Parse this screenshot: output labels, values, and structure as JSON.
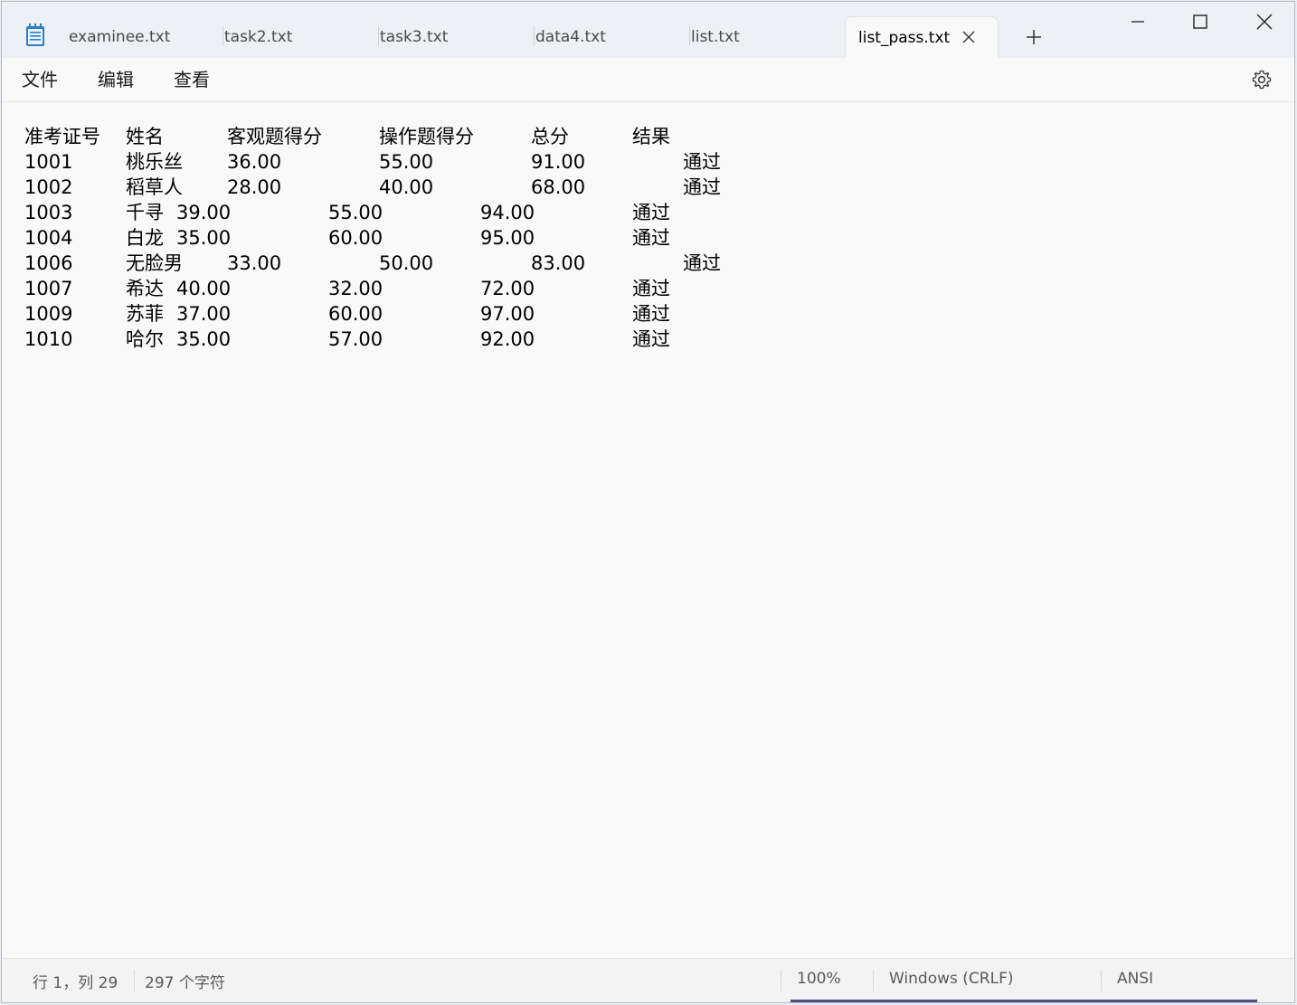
{
  "tabs": [
    {
      "label": "examinee.txt"
    },
    {
      "label": "task2.txt"
    },
    {
      "label": "task3.txt"
    },
    {
      "label": "data4.txt"
    },
    {
      "label": "list.txt"
    },
    {
      "label": "list_pass.txt",
      "active": true
    }
  ],
  "window_controls": [
    "minimize-icon",
    "maximize-icon",
    "close-icon"
  ],
  "menu": {
    "file": "文件",
    "edit": "编辑",
    "view": "查看"
  },
  "document": {
    "header": [
      "准考证号",
      "姓名",
      "客观题得分",
      "操作题得分",
      "总分",
      "结果"
    ],
    "rows": [
      [
        "1001",
        "桃乐丝",
        "36.00",
        "55.00",
        "91.00",
        "通过"
      ],
      [
        "1002",
        "稻草人",
        "28.00",
        "40.00",
        "68.00",
        "通过"
      ],
      [
        "1003",
        "千寻",
        "39.00",
        "55.00",
        "94.00",
        "通过"
      ],
      [
        "1004",
        "白龙",
        "35.00",
        "60.00",
        "95.00",
        "通过"
      ],
      [
        "1006",
        "无脸男",
        "33.00",
        "50.00",
        "83.00",
        "通过"
      ],
      [
        "1007",
        "希达",
        "40.00",
        "32.00",
        "72.00",
        "通过"
      ],
      [
        "1009",
        "苏菲",
        "37.00",
        "60.00",
        "97.00",
        "通过"
      ],
      [
        "1010",
        "哈尔",
        "35.00",
        "57.00",
        "92.00",
        "通过"
      ]
    ]
  },
  "status": {
    "position": "行 1，列 29",
    "char_count": "297 个字符",
    "zoom": "100%",
    "line_ending": "Windows (CRLF)",
    "encoding": "ANSI"
  },
  "colors": {
    "accent": "#4a4f86",
    "icon_blue": "#1f6fb2"
  }
}
